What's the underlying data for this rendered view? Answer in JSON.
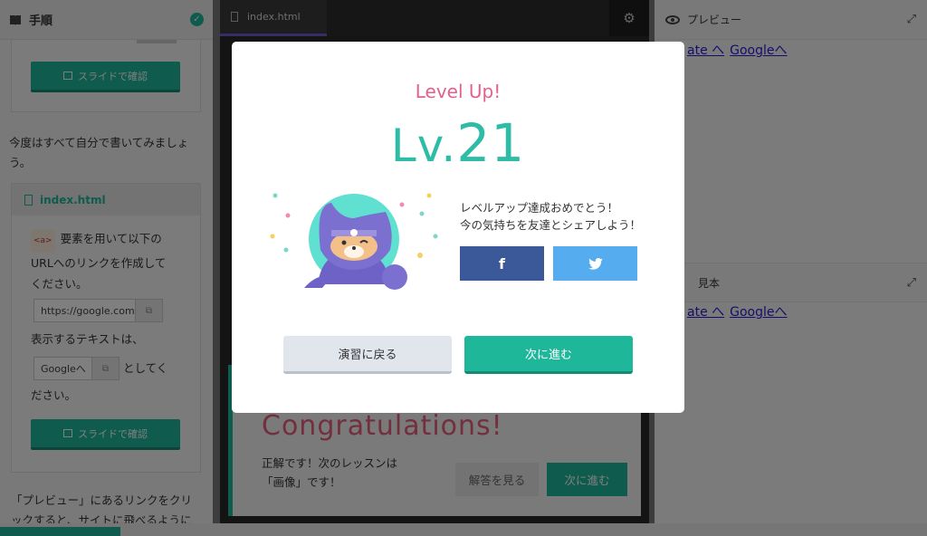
{
  "left_panel": {
    "title": "手順",
    "slide_button_label": "スライドで確認",
    "intro_text_1": "今度はすべて自分で書いてみましょ",
    "intro_text_2": "う。",
    "file_name": "index.html",
    "tag_label": "<a>",
    "instruction_1": "要素を用いて以下の",
    "instruction_2": "URLへのリンクを作成して",
    "instruction_3": "ください。",
    "url_value": "https://google.com",
    "display_text_label": "表示するテキストは、",
    "link_text_value": "Googleへ",
    "suffix_1": "としてく",
    "suffix_2": "ださい。",
    "bottom_text_1": "「プレビュー」にあるリンクをクリ",
    "bottom_text_2": "ックすると、サイトに飛べるように"
  },
  "editor": {
    "tab_label": "index.html"
  },
  "congrats_card": {
    "heading": "Congratulations!",
    "message_1": "正解です！次のレッスンは",
    "message_2": "「画像」です！",
    "answer_button": "解答を見る",
    "next_button": "次に進む"
  },
  "right_panel": {
    "preview_title": "プレビュー",
    "link_1": "ate へ",
    "link_2": "Googleへ",
    "sample_title": "見本",
    "sample_link_1": "ate へ",
    "sample_link_2": "Googleへ"
  },
  "modal": {
    "level_up_label": "Level Up!",
    "level_prefix": "Lv.",
    "level_number": "21",
    "message_line_1": "レベルアップ達成おめでとう！",
    "message_line_2": "今の気持ちを友達とシェアしよう！",
    "facebook_glyph": "f",
    "back_button": "演習に戻る",
    "next_button": "次に進む"
  },
  "colors": {
    "accent_green": "#1fb79a",
    "level_teal": "#2ebca6",
    "level_up_pink": "#e65f8a",
    "facebook_blue": "#3b5998",
    "twitter_blue": "#55acee"
  },
  "icons": [
    "book-icon",
    "check-icon",
    "document-icon",
    "gear-icon",
    "eye-icon",
    "expand-icon",
    "copy-icon",
    "facebook-icon",
    "twitter-icon"
  ]
}
